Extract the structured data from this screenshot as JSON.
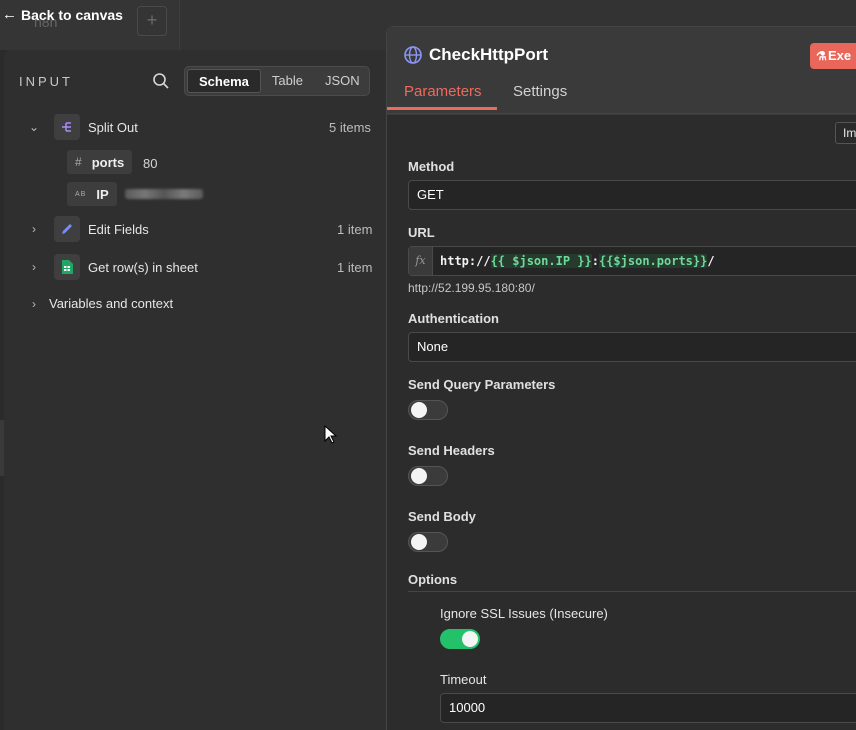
{
  "canvas": {
    "back_label": "Back to canvas",
    "ghost_label": "n8n",
    "plus": "+"
  },
  "input_panel": {
    "title": "INPUT",
    "view_options": [
      "Schema",
      "Table",
      "JSON"
    ],
    "selected_view": "Schema",
    "nodes": [
      {
        "name": "Split Out",
        "count": "5 items",
        "expanded": true,
        "icon": "split-out-icon"
      },
      {
        "name": "Edit Fields",
        "count": "1 item",
        "expanded": false,
        "icon": "pencil-icon"
      },
      {
        "name": "Get row(s) in sheet",
        "count": "1 item",
        "expanded": false,
        "icon": "google-sheets-icon"
      }
    ],
    "fields": [
      {
        "type_glyph": "#",
        "name": "ports",
        "value": "80"
      },
      {
        "type_glyph": "AB",
        "name": "IP",
        "value": ""
      }
    ],
    "variables_label": "Variables and context"
  },
  "node": {
    "title": "CheckHttpPort",
    "execute_label": "Exe",
    "tabs": [
      "Parameters",
      "Settings"
    ],
    "active_tab": "Parameters",
    "import_label": "Im",
    "method": {
      "label": "Method",
      "value": "GET"
    },
    "url": {
      "label": "URL",
      "prefix": "http://",
      "expr1": "{{ $json.IP }}",
      "sep": ":",
      "expr2": "{{$json.ports}}",
      "suffix": "/",
      "resolved": "http://52.199.95.180:80/"
    },
    "authentication": {
      "label": "Authentication",
      "value": "None"
    },
    "send_query": {
      "label": "Send Query Parameters",
      "on": false
    },
    "send_headers": {
      "label": "Send Headers",
      "on": false
    },
    "send_body": {
      "label": "Send Body",
      "on": false
    },
    "options_label": "Options",
    "ignore_ssl": {
      "label": "Ignore SSL Issues (Insecure)",
      "on": true
    },
    "timeout": {
      "label": "Timeout",
      "value": "10000"
    }
  },
  "colors": {
    "accent": "#ee6a5d",
    "toggle_on": "#23c26a",
    "expression": "#6fd99a"
  }
}
